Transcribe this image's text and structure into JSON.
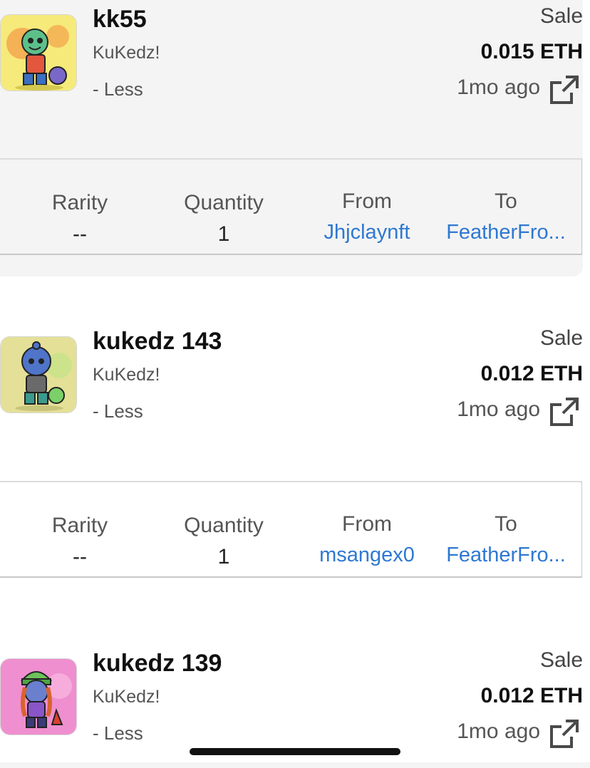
{
  "items": [
    {
      "title": "kk55",
      "collection": "KuKedz!",
      "toggle_label": "- Less",
      "event_type": "Sale",
      "price": "0.015 ETH",
      "time_ago": "1mo ago",
      "details": {
        "rarity_label": "Rarity",
        "rarity_value": "--",
        "quantity_label": "Quantity",
        "quantity_value": "1",
        "from_label": "From",
        "from_value": "Jhjclaynft",
        "to_label": "To",
        "to_value": "FeatherFro..."
      },
      "thumb_bg": "#f6ea7a",
      "icon": "external-link-icon"
    },
    {
      "title": "kukedz 143",
      "collection": "KuKedz!",
      "toggle_label": "- Less",
      "event_type": "Sale",
      "price": "0.012 ETH",
      "time_ago": "1mo ago",
      "details": {
        "rarity_label": "Rarity",
        "rarity_value": "--",
        "quantity_label": "Quantity",
        "quantity_value": "1",
        "from_label": "From",
        "from_value": "msangex0",
        "to_label": "To",
        "to_value": "FeatherFro..."
      },
      "thumb_bg": "#e4e097",
      "icon": "external-link-icon"
    },
    {
      "title": "kukedz 139",
      "collection": "KuKedz!",
      "toggle_label": "- Less",
      "event_type": "Sale",
      "price": "0.012 ETH",
      "time_ago": "1mo ago",
      "thumb_bg": "#ef8fcf",
      "icon": "external-link-icon"
    }
  ],
  "colors": {
    "link": "#2e78d2",
    "card_bg": "#f4f4f4"
  }
}
